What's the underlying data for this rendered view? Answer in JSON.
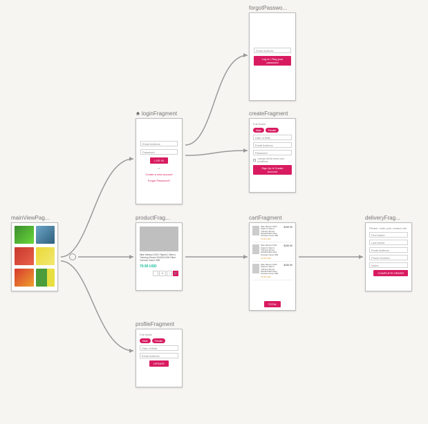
{
  "nodes": {
    "main": {
      "label": "mainViewPag..."
    },
    "login": {
      "label": "loginFragment",
      "email_ph": "Email Address",
      "pass_ph": "Password",
      "login_btn": "LOG IN",
      "or": "or",
      "create": "Create a new account",
      "forgot": "Forgot Password?"
    },
    "forgot": {
      "label": "forgotPasswo...",
      "email_ph": "Email Address",
      "btn": "Log In / Reg your password"
    },
    "create": {
      "label": "createFragment",
      "fullname": "Full Name",
      "male": "Male",
      "female": "Female",
      "dob_ph": "Date of Birth",
      "email_ph": "Email Address",
      "pass_ph": "Password",
      "terms": "I accept all the terms and conditions",
      "btn": "Sign Up & Create Account"
    },
    "product": {
      "label": "productFrag...",
      "title": "Nike Metcon DSX Flyknit 2 Men's Training Shoes 924423-006 Olive Canvas Camo NIB",
      "price": "79.95 USD",
      "qty": "1"
    },
    "cart": {
      "label": "cartFragment",
      "item_title": "Nike Metcon DSX Flyknit 2 Men's Training Shoes 924423-006 Olive Canvas Camo NIB",
      "item_sub": "79.95 USD",
      "item_price": "$159.90",
      "total_btn": "TOTAL"
    },
    "delivery": {
      "label": "deliveryFrag...",
      "heading": "Please, enter your contact info",
      "first_ph": "First Name",
      "last_ph": "Last Name",
      "email_ph": "Email Address",
      "phone_ph": "Phone Number",
      "notes_ph": "Notes",
      "btn": "COMPLETE ORDER"
    },
    "profile": {
      "label": "profileFragment",
      "fullname": "Full Name",
      "male": "Male",
      "female": "Female",
      "dob_ph": "Date of Birth",
      "email_ph": "Email Address",
      "btn": "UPDATE"
    }
  }
}
